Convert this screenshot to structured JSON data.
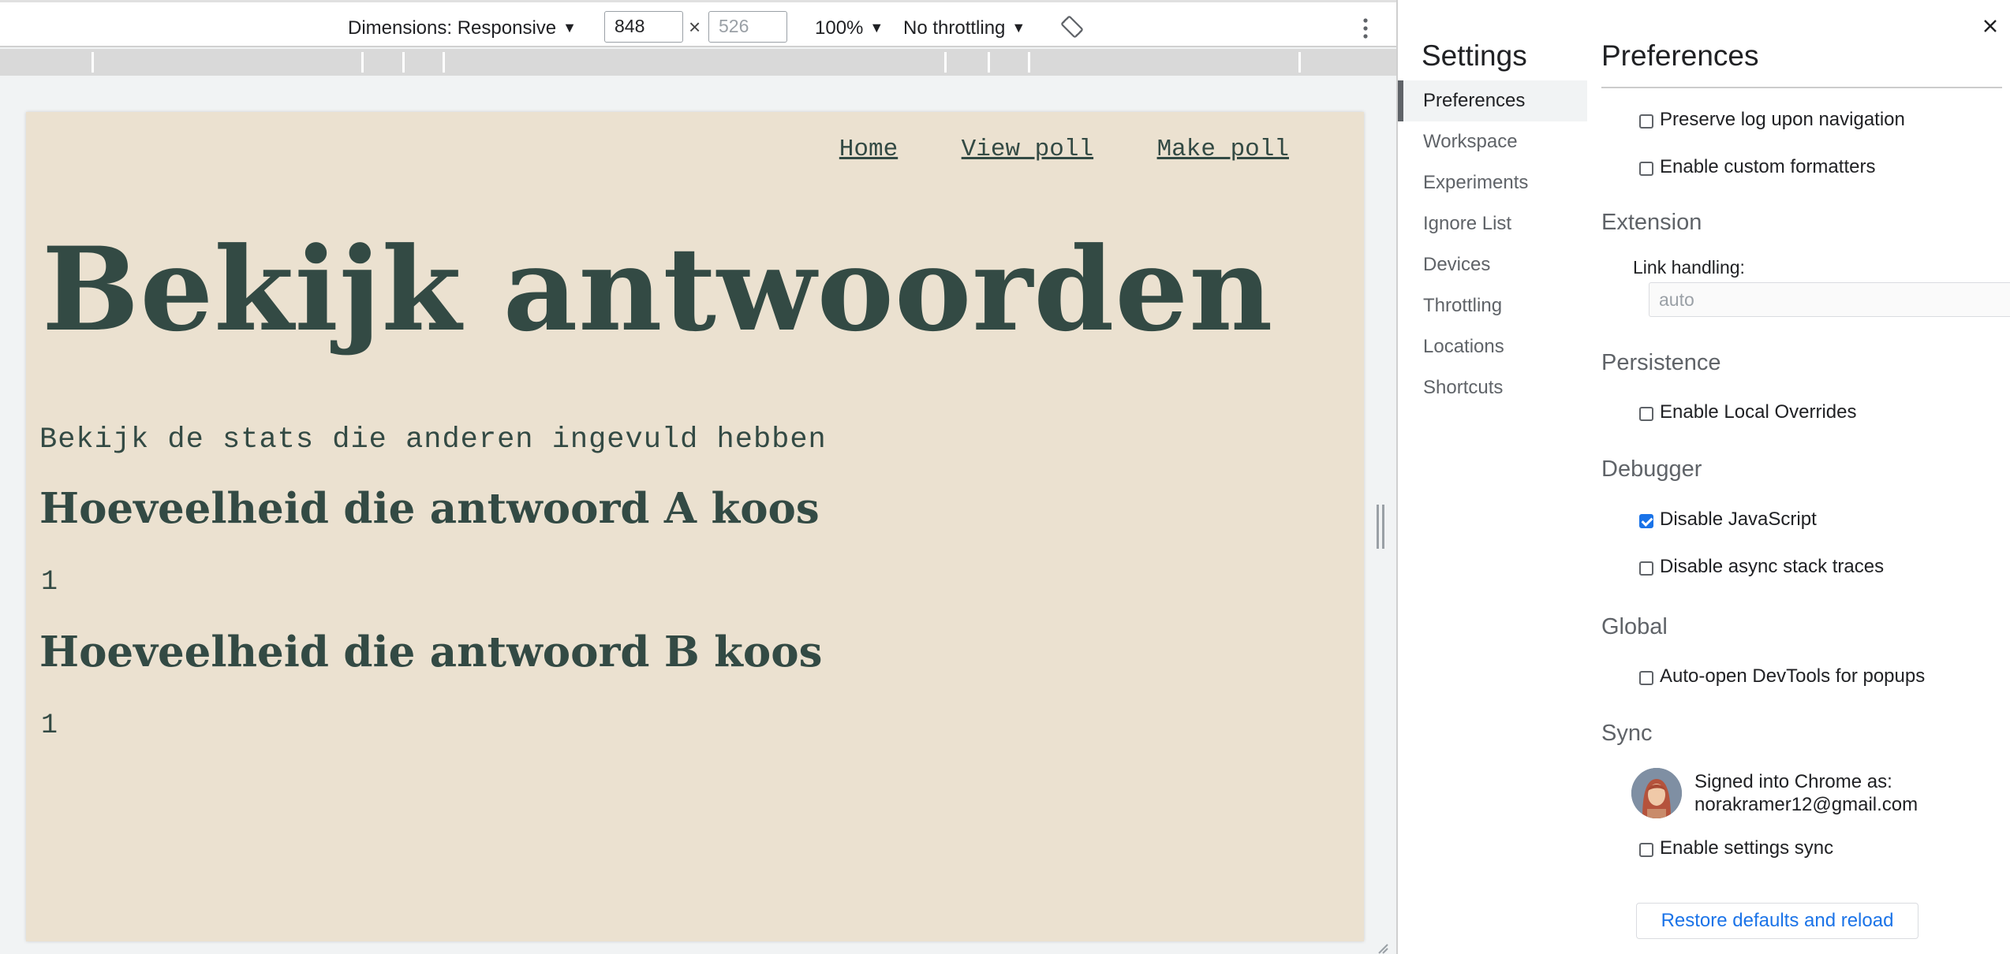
{
  "toolbar": {
    "dimensions_label": "Dimensions: Responsive",
    "width_value": "848",
    "height_placeholder": "526",
    "times": "×",
    "zoom_label": "100%",
    "throttling_label": "No throttling"
  },
  "page": {
    "nav": {
      "home": "Home",
      "view_poll": "View poll",
      "make_poll": "Make poll"
    },
    "heading": "Bekijk antwoorden",
    "intro": "Bekijk de stats die anderen ingevuld hebben",
    "answers": [
      {
        "heading": "Hoeveelheid die antwoord A koos",
        "count": "1"
      },
      {
        "heading": "Hoeveelheid die antwoord B koos",
        "count": "1"
      }
    ]
  },
  "settings": {
    "title": "Settings",
    "close_icon": "close-icon",
    "nav": [
      "Preferences",
      "Workspace",
      "Experiments",
      "Ignore List",
      "Devices",
      "Throttling",
      "Locations",
      "Shortcuts"
    ],
    "active_nav": "Preferences",
    "preferences": {
      "title": "Preferences",
      "console_options": [
        {
          "label": "Preserve log upon navigation",
          "checked": false
        },
        {
          "label": "Enable custom formatters",
          "checked": false
        }
      ],
      "extension": {
        "title": "Extension",
        "link_handling_label": "Link handling:",
        "link_handling_value": "auto"
      },
      "persistence": {
        "title": "Persistence",
        "options": [
          {
            "label": "Enable Local Overrides",
            "checked": false
          }
        ]
      },
      "debugger": {
        "title": "Debugger",
        "options": [
          {
            "label": "Disable JavaScript",
            "checked": true
          },
          {
            "label": "Disable async stack traces",
            "checked": false
          }
        ]
      },
      "global": {
        "title": "Global",
        "options": [
          {
            "label": "Auto-open DevTools for popups",
            "checked": false
          }
        ]
      },
      "sync": {
        "title": "Sync",
        "signed_in_line1": "Signed into Chrome as:",
        "signed_in_email": "norakramer12@gmail.com",
        "options": [
          {
            "label": "Enable settings sync",
            "checked": false
          }
        ]
      },
      "restore_button": "Restore defaults and reload"
    }
  },
  "colors": {
    "page_background": "#ebe1d0",
    "page_text": "#334a44",
    "accent_blue": "#1a73e8"
  }
}
